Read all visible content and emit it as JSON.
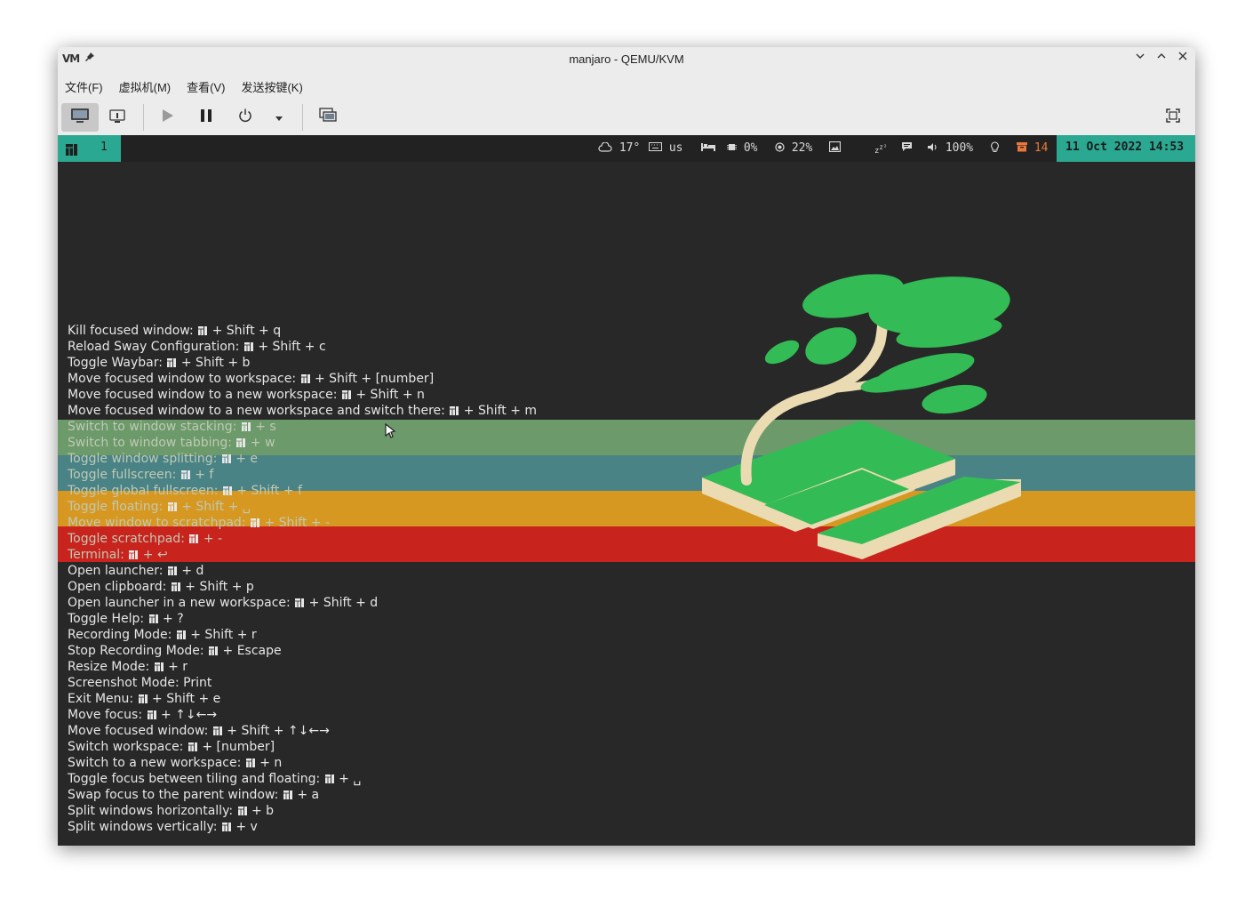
{
  "window": {
    "title": "manjaro - QEMU/KVM",
    "app_icon_label": "VM"
  },
  "menubar": {
    "items": [
      {
        "label": "文件(F)"
      },
      {
        "label": "虚拟机(M)"
      },
      {
        "label": "查看(V)"
      },
      {
        "label": "发送按键(K)"
      }
    ]
  },
  "toolbar": {
    "icons": [
      "console-icon",
      "details-icon",
      "run-icon",
      "pause-icon",
      "shutdown-icon",
      "shutdown-menu-icon",
      "snapshot-icon",
      "fullscreen-icon"
    ]
  },
  "waybar": {
    "workspace": "1",
    "weather": "17°",
    "keyboard_layout": "us",
    "cpu": "0%",
    "memory": "22%",
    "volume": "100%",
    "updates": "14",
    "clock": "11 Oct 2022 14:53",
    "accent_color": "#2aa891",
    "updates_color": "#e8773c"
  },
  "help": {
    "bindings": [
      {
        "action": "Kill focused window:",
        "keys": "+ Shift + q"
      },
      {
        "action": "Reload Sway Configuration:",
        "keys": "+ Shift + c"
      },
      {
        "action": "Toggle Waybar:",
        "keys": "+ Shift + b"
      },
      {
        "action": "Move focused window to workspace:",
        "keys": "+ Shift + [number]"
      },
      {
        "action": "Move focused window to a new workspace:",
        "keys": "+ Shift + n"
      },
      {
        "action": "Move focused window to a new workspace and switch there:",
        "keys": "+ Shift + m"
      },
      {
        "action": "Switch to window stacking:",
        "keys": "+ s"
      },
      {
        "action": "Switch to window tabbing:",
        "keys": "+ w"
      },
      {
        "action": "Toggle window splitting:",
        "keys": "+ e"
      },
      {
        "action": "Toggle fullscreen:",
        "keys": "+ f"
      },
      {
        "action": "Toggle global fullscreen:",
        "keys": "+ Shift + f"
      },
      {
        "action": "Toggle floating:",
        "keys": "+ Shift + ␣"
      },
      {
        "action": "Move window to scratchpad:",
        "keys": "+ Shift + -"
      },
      {
        "action": "Toggle scratchpad:",
        "keys": "+ -"
      },
      {
        "action": "Terminal:",
        "keys": "+ ↩"
      },
      {
        "action": "Open launcher:",
        "keys": "+ d"
      },
      {
        "action": "Open clipboard:",
        "keys": "+ Shift + p"
      },
      {
        "action": "Open launcher in a new workspace:",
        "keys": "+ Shift + d"
      },
      {
        "action": "Toggle Help:",
        "keys": "+ ?"
      },
      {
        "action": "Recording Mode:",
        "keys": "+ Shift + r"
      },
      {
        "action": "Stop Recording Mode:",
        "keys": "+ Escape"
      },
      {
        "action": "Resize Mode:",
        "keys": "+ r"
      },
      {
        "action": "Screenshot Mode:",
        "keys": "Print"
      },
      {
        "action": "Exit Menu:",
        "keys": "+ Shift + e"
      },
      {
        "action": "Move focus:",
        "keys": "+ ↑↓←→"
      },
      {
        "action": "Move focused window:",
        "keys": "+ Shift + ↑↓←→"
      },
      {
        "action": "Switch workspace:",
        "keys": "+ [number]"
      },
      {
        "action": "Switch to a new workspace:",
        "keys": "+ n"
      },
      {
        "action": "Toggle focus between tiling and floating:",
        "keys": "+ ␣"
      },
      {
        "action": "Swap focus to the parent window:",
        "keys": "+ a"
      },
      {
        "action": "Split windows horizontally:",
        "keys": "+ b"
      },
      {
        "action": "Split windows vertically:",
        "keys": "+ v"
      }
    ]
  },
  "wallpaper": {
    "stripe_colors": [
      "#6c9a6a",
      "#4a8386",
      "#d79822",
      "#c9231e"
    ],
    "tree_leaf_color": "#33bb55",
    "tree_trunk_color": "#ebdbb2"
  }
}
